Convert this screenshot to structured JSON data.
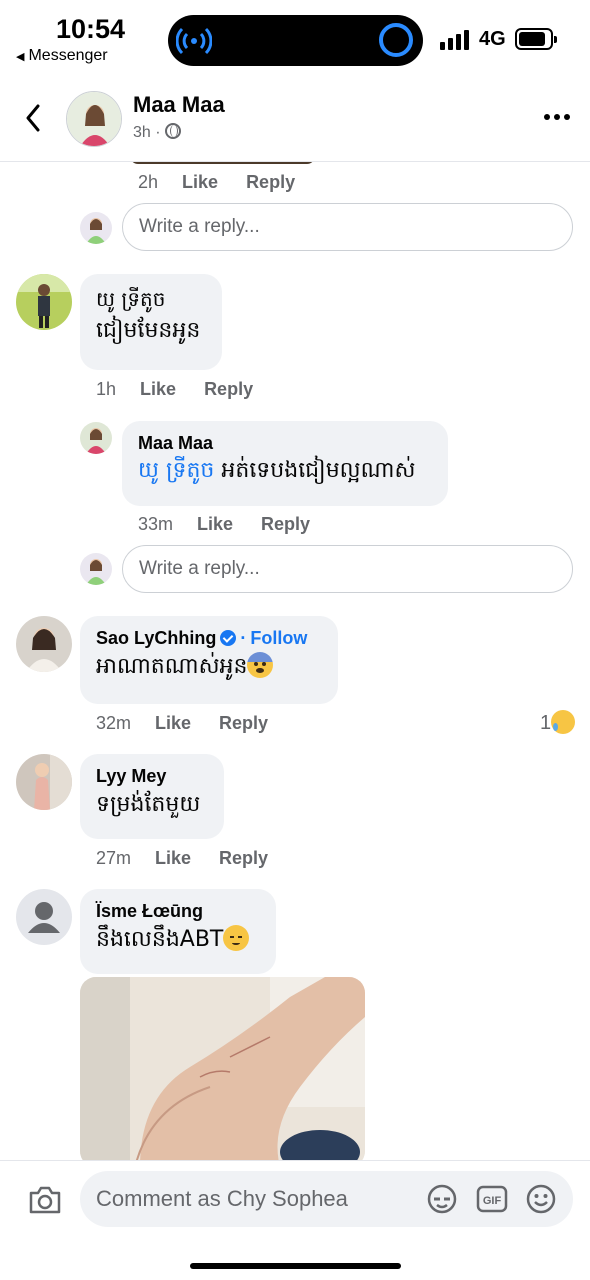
{
  "status_bar": {
    "time": "10:54",
    "back_app": "Messenger",
    "network": "4G"
  },
  "header": {
    "name": "Maa Maa",
    "time": "3h",
    "dot": "·"
  },
  "comments": {
    "prev_reply": {
      "time": "2h",
      "like": "Like",
      "reply": "Reply"
    },
    "reply_box_1": {
      "placeholder": "Write a reply..."
    },
    "c1": {
      "name": "យូ ទ្រីតូច",
      "text": "ជៀមមែនអូន",
      "time": "1h",
      "like": "Like",
      "reply": "Reply"
    },
    "c1_reply": {
      "name": "Maa Maa",
      "mention": "យូ ទ្រីតូច",
      "text": " អត់ទេបងជៀមល្អណាស់",
      "time": "33m",
      "like": "Like",
      "reply": "Reply"
    },
    "reply_box_2": {
      "placeholder": "Write a reply..."
    },
    "c2": {
      "name": "Sao LyChhing",
      "separator": "·",
      "follow": "Follow",
      "text": "អាណាតណាស់អូន",
      "emoji": "fearful-face-emoji",
      "time": "32m",
      "like": "Like",
      "reply": "Reply",
      "reaction_count": "1",
      "reaction_icon": "crying-face-icon"
    },
    "c3": {
      "name": "Lyy Mey",
      "text": "ទម្រង់តែមួយ",
      "time": "27m",
      "like": "Like",
      "reply": "Reply"
    },
    "c4": {
      "name": "Ïsme Łœūng",
      "text": "នឹងលេនឹងABT",
      "emoji": "relieved-face-emoji"
    }
  },
  "composer": {
    "placeholder": "Comment as Chy Sophea"
  },
  "colors": {
    "accent": "#1877f2",
    "bubble": "#f0f2f5",
    "muted": "#65676b"
  }
}
